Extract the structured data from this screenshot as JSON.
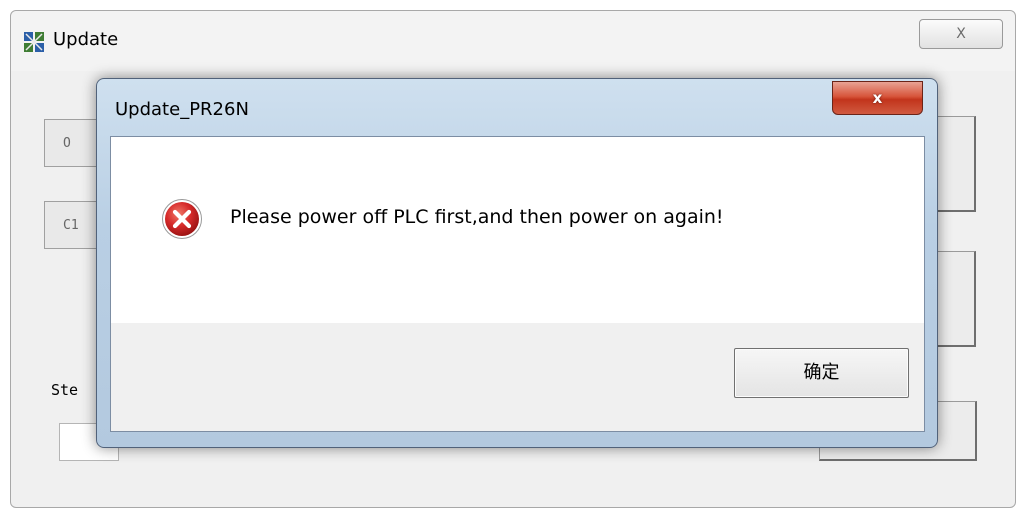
{
  "parent_window": {
    "title": "Update",
    "close_glyph": "X",
    "button1_label": "O",
    "button2_label": "C1",
    "step_label": "Ste"
  },
  "dialog": {
    "title": "Update_PR26N",
    "close_glyph": "x",
    "message": "Please power off PLC first,and then power on again!",
    "ok_label": "确定"
  },
  "icons": {
    "parent_app": "app-icon",
    "error": "error-icon"
  },
  "colors": {
    "dialog_frame": "#b9cfe4",
    "close_red": "#c2341c",
    "error_red": "#d62a2a"
  }
}
